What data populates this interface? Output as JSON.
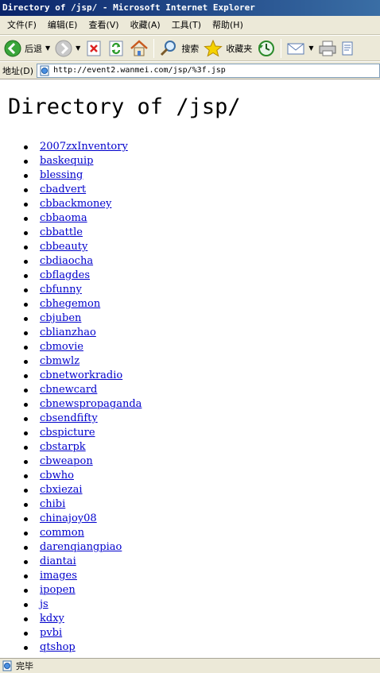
{
  "window": {
    "title": "Directory of /jsp/ - Microsoft Internet Explorer"
  },
  "menu": [
    "文件(F)",
    "编辑(E)",
    "查看(V)",
    "收藏(A)",
    "工具(T)",
    "帮助(H)"
  ],
  "toolbar": {
    "back_label": "后退",
    "search_label": "搜索",
    "favorites_label": "收藏夹"
  },
  "address": {
    "label": "地址(D)",
    "url": "http://event2.wanmei.com/jsp/%3f.jsp"
  },
  "page": {
    "heading": "Directory of /jsp/",
    "entries": [
      "2007zxInventory",
      "baskequip",
      "blessing",
      "cbadvert",
      "cbbackmoney",
      "cbbaoma",
      "cbbattle",
      "cbbeauty",
      "cbdiaocha",
      "cbflagdes",
      "cbfunny",
      "cbhegemon",
      "cbjuben",
      "cblianzhao",
      "cbmovie",
      "cbmwlz",
      "cbnetworkradio",
      "cbnewcard",
      "cbnewspropaganda",
      "cbsendfifty",
      "cbspicture",
      "cbstarpk",
      "cbweapon",
      "cbwho",
      "cbxiezai",
      "chibi",
      "chinajoy08",
      "common",
      "darenqiangpiao",
      "diantai",
      "images",
      "ipopen",
      "js",
      "kdxy",
      "pvbi",
      "qtshop"
    ]
  },
  "status": {
    "text": "完毕"
  },
  "colors": {
    "titlebar_start": "#0a246a",
    "titlebar_end": "#3a6ea5",
    "chrome": "#ece9d8",
    "link": "#0000cc"
  },
  "icons": [
    "back-icon",
    "forward-icon",
    "stop-icon",
    "refresh-icon",
    "home-icon",
    "search-icon",
    "favorites-icon",
    "history-icon",
    "mail-icon",
    "print-icon",
    "edit-icon",
    "page-icon"
  ]
}
